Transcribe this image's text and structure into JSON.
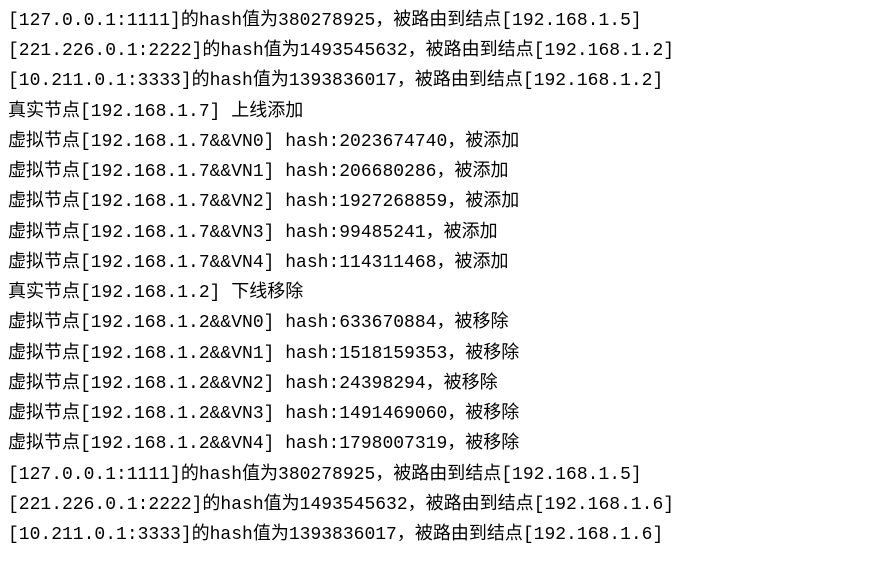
{
  "lines": [
    "[127.0.0.1:1111]的hash值为380278925，被路由到结点[192.168.1.5]",
    "[221.226.0.1:2222]的hash值为1493545632，被路由到结点[192.168.1.2]",
    "[10.211.0.1:3333]的hash值为1393836017，被路由到结点[192.168.1.2]",
    "真实节点[192.168.1.7] 上线添加",
    "虚拟节点[192.168.1.7&&VN0] hash:2023674740，被添加",
    "虚拟节点[192.168.1.7&&VN1] hash:206680286，被添加",
    "虚拟节点[192.168.1.7&&VN2] hash:1927268859，被添加",
    "虚拟节点[192.168.1.7&&VN3] hash:99485241，被添加",
    "虚拟节点[192.168.1.7&&VN4] hash:114311468，被添加",
    "真实节点[192.168.1.2] 下线移除",
    "虚拟节点[192.168.1.2&&VN0] hash:633670884，被移除",
    "虚拟节点[192.168.1.2&&VN1] hash:1518159353，被移除",
    "虚拟节点[192.168.1.2&&VN2] hash:24398294，被移除",
    "虚拟节点[192.168.1.2&&VN3] hash:1491469060，被移除",
    "虚拟节点[192.168.1.2&&VN4] hash:1798007319，被移除",
    "[127.0.0.1:1111]的hash值为380278925，被路由到结点[192.168.1.5]",
    "[221.226.0.1:2222]的hash值为1493545632，被路由到结点[192.168.1.6]",
    "[10.211.0.1:3333]的hash值为1393836017，被路由到结点[192.168.1.6]"
  ]
}
